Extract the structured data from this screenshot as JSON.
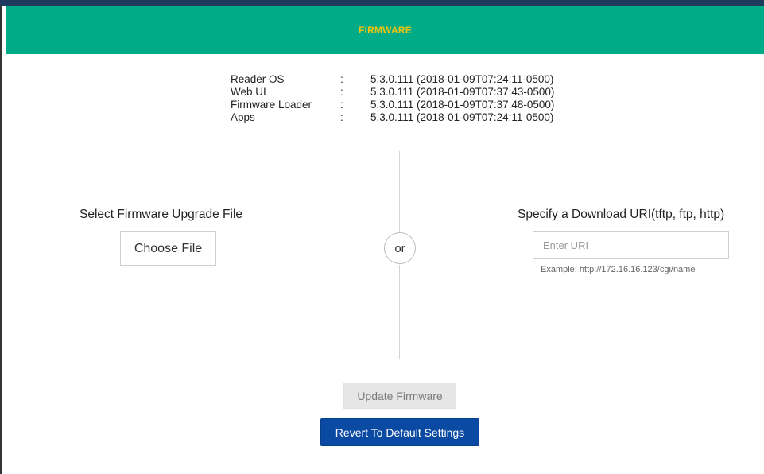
{
  "header": {
    "title": "FIRMWARE"
  },
  "versions": [
    {
      "name": "Reader OS",
      "sep": ":",
      "value": "5.3.0.111 (2018-01-09T07:24:11-0500)"
    },
    {
      "name": "Web UI",
      "sep": ":",
      "value": "5.3.0.111 (2018-01-09T07:37:43-0500)"
    },
    {
      "name": "Firmware Loader",
      "sep": ":",
      "value": "5.3.0.111 (2018-01-09T07:37:48-0500)"
    },
    {
      "name": "Apps",
      "sep": ":",
      "value": "5.3.0.111 (2018-01-09T07:24:11-0500)"
    }
  ],
  "upload": {
    "title": "Select Firmware Upgrade File",
    "choose_label": "Choose File"
  },
  "divider": {
    "or_label": "or"
  },
  "download": {
    "title": "Specify a Download URI(tftp, ftp, http)",
    "placeholder": "Enter URI",
    "value": "",
    "example": "Example: http://172.16.16.123/cgi/name"
  },
  "actions": {
    "update_label": "Update Firmware",
    "revert_label": "Revert To Default Settings"
  },
  "colors": {
    "header_bg": "#00ac87",
    "header_text": "#f1c40f",
    "primary_button": "#0b4aa2",
    "disabled_button": "#e6e6e6"
  }
}
